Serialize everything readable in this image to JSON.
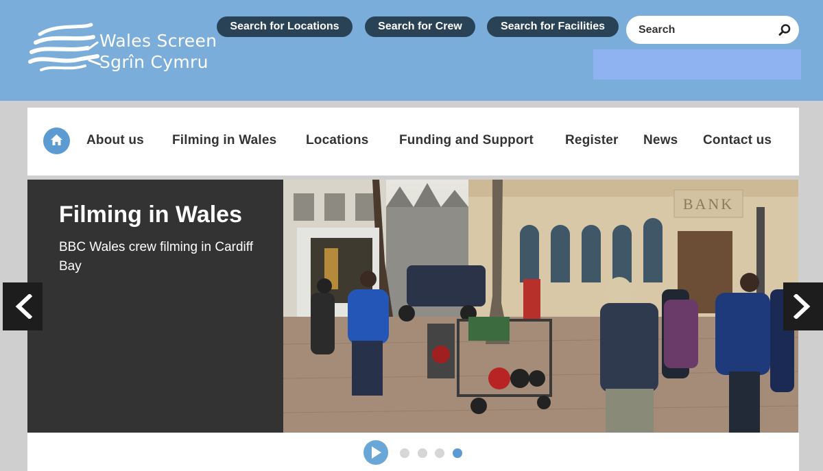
{
  "logo": {
    "line1": "Wales Screen",
    "line2": "Sgrîn Cymru"
  },
  "header": {
    "buttons": [
      {
        "label": "Search for Locations"
      },
      {
        "label": "Search for Crew"
      },
      {
        "label": "Search for Facilities"
      }
    ],
    "search": {
      "placeholder": "Search",
      "value": ""
    }
  },
  "nav": {
    "items": [
      {
        "label": "About us"
      },
      {
        "label": "Filming in Wales"
      },
      {
        "label": "Locations"
      },
      {
        "label": "Funding and Support"
      },
      {
        "label": "Register"
      },
      {
        "label": "News"
      },
      {
        "label": "Contact us"
      }
    ]
  },
  "slide": {
    "title": "Filming in Wales",
    "caption": "BBC Wales crew filming in Cardiff Bay",
    "sign_text": "BANK"
  },
  "carousel": {
    "slide_count": 4,
    "active_index": 4
  },
  "colors": {
    "header_bg": "#7aadd9",
    "pill_bg": "#2a4256",
    "accent": "#5b9bd1",
    "caption_bg": "#333333"
  },
  "icons": {
    "home": "home-icon",
    "search": "search-icon",
    "prev": "chevron-left-icon",
    "next": "chevron-right-icon",
    "play": "play-icon"
  }
}
